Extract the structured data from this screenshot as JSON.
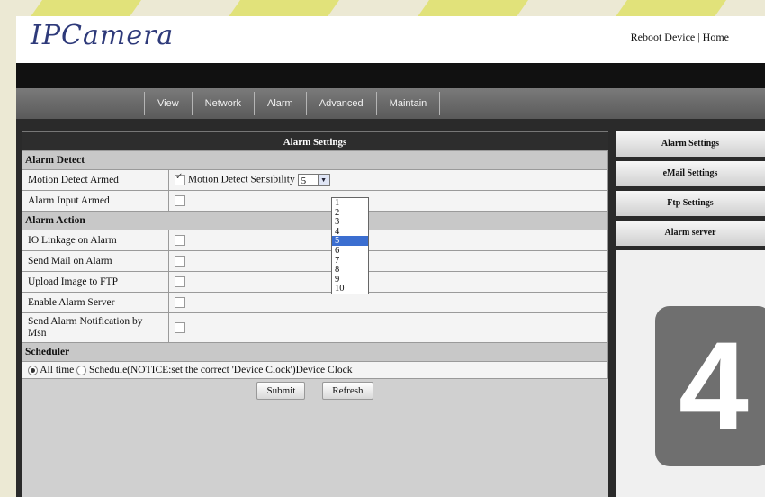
{
  "header": {
    "logo": "IPCamera",
    "links": [
      "Reboot Device",
      "Home"
    ],
    "link_sep": "|"
  },
  "nav": [
    "View",
    "Network",
    "Alarm",
    "Advanced",
    "Maintain"
  ],
  "main": {
    "title": "Alarm Settings",
    "sections": {
      "detect": "Alarm Detect",
      "action": "Alarm Action",
      "scheduler": "Scheduler"
    },
    "rows": {
      "motion": "Motion Detect Armed",
      "motion_sens_label": "Motion Detect Sensibility",
      "motion_sens_value": "5",
      "input": "Alarm Input Armed",
      "io": "IO Linkage on Alarm",
      "mail": "Send Mail on Alarm",
      "ftp": "Upload Image to FTP",
      "server": "Enable Alarm Server",
      "notify": "Send Alarm Notification by Msn"
    },
    "sensibility_options": [
      "1",
      "2",
      "3",
      "4",
      "5",
      "6",
      "7",
      "8",
      "9",
      "10"
    ],
    "scheduler": {
      "all_time": "All time",
      "schedule": "Schedule(NOTICE:set the correct 'Device Clock')Device Clock"
    },
    "buttons": {
      "submit": "Submit",
      "refresh": "Refresh"
    }
  },
  "side": [
    "Alarm Settings",
    "eMail Settings",
    "Ftp Settings",
    "Alarm server"
  ],
  "badge": "4"
}
